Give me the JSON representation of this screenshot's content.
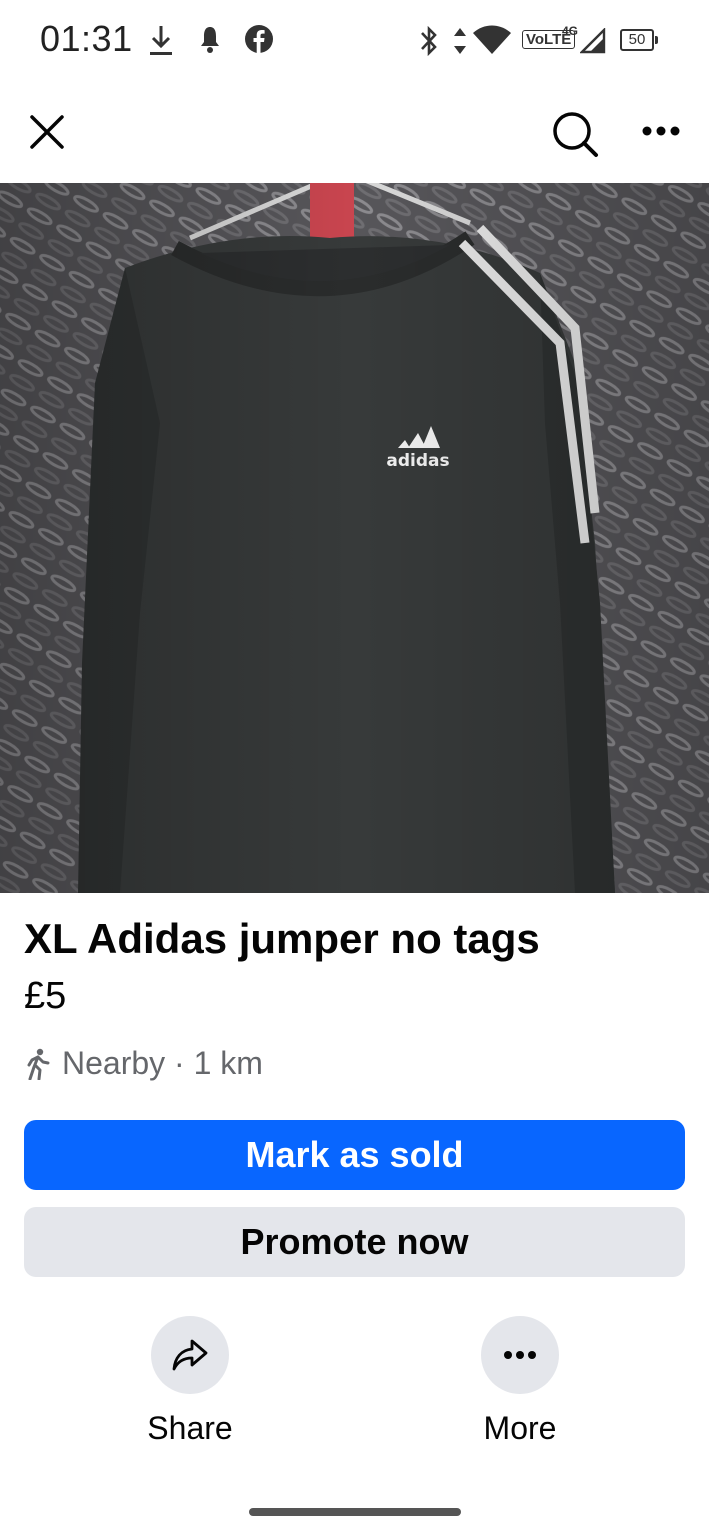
{
  "status_bar": {
    "time": "01:31",
    "network_label": "VoLTE",
    "network_type": "4G",
    "battery": "50",
    "icons": [
      "download-icon",
      "notification-icon",
      "facebook-icon",
      "bluetooth-icon",
      "data-arrows-icon",
      "wifi-icon",
      "signal-icon",
      "battery-icon"
    ]
  },
  "header": {
    "close_icon": "close-icon",
    "search_icon": "search-icon",
    "more_icon": "more-icon"
  },
  "listing": {
    "image_brand": "adidas",
    "title": "XL Adidas jumper no tags",
    "price": "£5",
    "location": "Nearby · 1 km",
    "location_icon": "walking-person-icon"
  },
  "buttons": {
    "mark_sold": "Mark as sold",
    "promote": "Promote now"
  },
  "actions": {
    "share": "Share",
    "more": "More"
  },
  "colors": {
    "primary": "#0866ff",
    "secondary_bg": "#e4e6eb",
    "muted_text": "#65676b"
  }
}
